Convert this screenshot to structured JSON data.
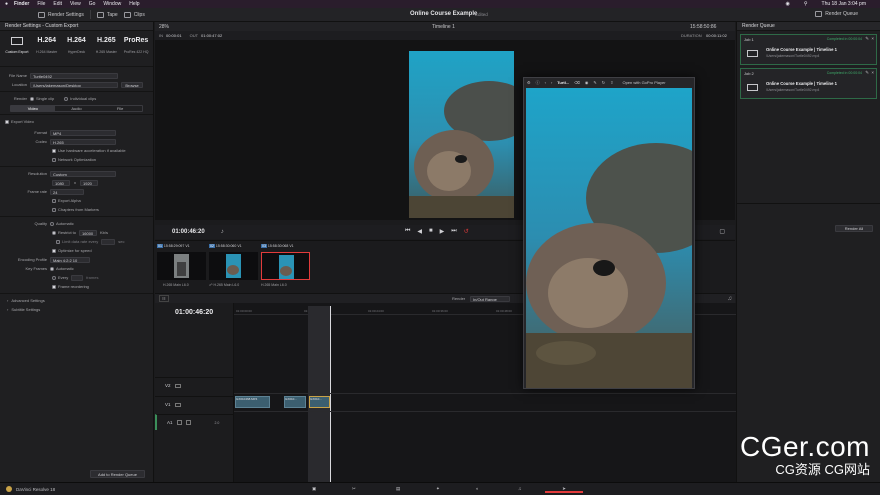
{
  "menubar": {
    "items": [
      "Finder",
      "File",
      "Edit",
      "View",
      "Go",
      "Window",
      "Help"
    ],
    "clock": "Thu 18 Jan  3:04 pm"
  },
  "toolbar": {
    "render_settings": "Render Settings",
    "tape": "Tape",
    "clips": "Clips",
    "project_title": "Online Course Example",
    "project_status": "Edited",
    "render_queue": "Render Queue"
  },
  "render_settings": {
    "header": "Render Settings - Custom Export",
    "presets": [
      {
        "big": "",
        "sub": "Custom Export"
      },
      {
        "big": "H.264",
        "sub": "H.264 Master"
      },
      {
        "big": "H.264",
        "sub": "HyperDeck"
      },
      {
        "big": "H.265",
        "sub": "H.265 Master"
      },
      {
        "big": "ProRes",
        "sub": "ProRes 422 HQ"
      }
    ],
    "file_name_label": "File Name",
    "file_name": "Turtle0492",
    "location_label": "Location",
    "location": "/Users/jakemason/Desktop",
    "browse": "Browse",
    "render_label": "Render",
    "single_clip": "Single clip",
    "individual_clips": "Individual clips",
    "tabs": [
      "Video",
      "Audio",
      "File"
    ],
    "export_video": "Export Video",
    "format_label": "Format",
    "format": "MP4",
    "codec_label": "Codec",
    "codec": "H.265",
    "hw_accel": "Use hardware acceleration if available",
    "network_opt": "Network Optimization",
    "resolution_label": "Resolution",
    "resolution": "Custom",
    "res_w": "1080",
    "res_x": "x",
    "res_h": "1920",
    "frame_rate_label": "Frame rate",
    "frame_rate": "24",
    "export_alpha": "Export Alpha",
    "chapters": "Chapters from Markers",
    "quality_label": "Quality",
    "automatic": "Automatic",
    "restrict_to": "Restrict to",
    "restrict_val": "16000",
    "restrict_unit": "Kb/s",
    "limit_rate": "Limit data rate every",
    "sec": "sec",
    "optimize_speed": "Optimize for speed",
    "enc_profile_label": "Encoding Profile",
    "enc_profile": "Main 4:2:2 10",
    "keyframes_label": "Key Frames",
    "kf_auto": "Automatic",
    "every": "Every",
    "frames": "frames",
    "frame_reorder": "Frame reordering",
    "advanced": "Advanced Settings",
    "subtitle": "Subtitle Settings",
    "add_queue": "Add to Render Queue"
  },
  "viewer": {
    "zoom": "28%",
    "timeline_name": "Timeline 1",
    "in_label": "IN",
    "in_tc": "00:00:01",
    "out_label": "OUT",
    "out_tc": "01:00:47:02",
    "clip_tc": "15:58:50:86",
    "duration_label": "DURATION",
    "duration": "00:00:11:02",
    "timecode": "01:00:46:20"
  },
  "gopro_window": {
    "title": "Turtl...",
    "open_with": "Open with GoPro Player"
  },
  "render_queue": {
    "title": "Render Queue",
    "jobs": [
      {
        "id": "Job 1",
        "status": "Completed in 00:00:04",
        "title": "Online Course Example | Timeline 1",
        "path": "/Users/jakemason/Turtle0492.mp4"
      },
      {
        "id": "Job 2",
        "status": "Completed in 00:00:04",
        "title": "Online Course Example | Timeline 1",
        "path": "/Users/jakemason/Turtle0492.mp4"
      }
    ],
    "render_all": "Render All"
  },
  "clips": [
    {
      "num": "01",
      "tc": "15:58:29:097",
      "track": "V1",
      "codec": "H.265 Main L6.0"
    },
    {
      "num": "02",
      "tc": "15:58:30:060",
      "track": "V1",
      "codec": "H.265 Main L6.0"
    },
    {
      "num": "03",
      "tc": "15:58:30:068",
      "track": "V1",
      "codec": "H.265 Main L6.0"
    }
  ],
  "timeline": {
    "render_label": "Render",
    "render_range": "In/Out Range",
    "timecode": "01:00:46:20",
    "ruler": [
      "01:00:00:00",
      "01:00:12:00",
      "01:00:24:00",
      "01:00:36:00",
      "01:00:48:00",
      "01:01:00:00",
      "01:01:12:00"
    ],
    "tracks": [
      "V2",
      "V1",
      "A1"
    ],
    "clip_labels": [
      "GX010468.MP4",
      "GX010...",
      "GX010...",
      "GX0104..."
    ],
    "a1_level": "2.0"
  },
  "bottom": {
    "app_name": "DaVinci Resolve 18"
  },
  "watermark": {
    "line1": "CGer.com",
    "line2": "CG资源 CG网站"
  },
  "colors": {
    "accent_red": "#e23b3b",
    "completed_green": "#3fae6b"
  }
}
